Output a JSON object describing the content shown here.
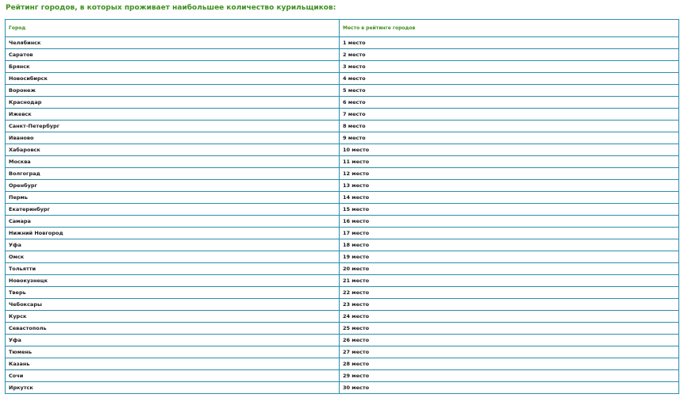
{
  "page": {
    "title": "Рейтинг городов, в которых проживает наибольшее количество курильщиков:"
  },
  "table": {
    "headers": {
      "city": "Город",
      "place": "Место в рейтинге городов"
    },
    "rows": [
      {
        "city": "Челябинск",
        "place": "1 место"
      },
      {
        "city": "Саратов",
        "place": "2 место"
      },
      {
        "city": "Брянск",
        "place": "3 место"
      },
      {
        "city": "Новосибирск",
        "place": "4 место"
      },
      {
        "city": "Воронеж",
        "place": "5 место"
      },
      {
        "city": "Краснодар",
        "place": "6 место"
      },
      {
        "city": "Ижевск",
        "place": "7 место"
      },
      {
        "city": "Санкт-Петербург",
        "place": "8 место"
      },
      {
        "city": "Иваново",
        "place": "9 место"
      },
      {
        "city": "Хабаровск",
        "place": "10 место"
      },
      {
        "city": "Москва",
        "place": "11 место"
      },
      {
        "city": "Волгоград",
        "place": "12 место"
      },
      {
        "city": "Оренбург",
        "place": "13 место"
      },
      {
        "city": "Пермь",
        "place": "14 место"
      },
      {
        "city": "Екатеринбург",
        "place": "15 место"
      },
      {
        "city": "Самара",
        "place": "16 место"
      },
      {
        "city": "Нижний Новгород",
        "place": "17 место"
      },
      {
        "city": "Уфа",
        "place": "18 место"
      },
      {
        "city": "Омск",
        "place": "19 место"
      },
      {
        "city": "Тольятти",
        "place": "20 место"
      },
      {
        "city": "Новокузнецк",
        "place": "21 место"
      },
      {
        "city": "Тверь",
        "place": "22 место"
      },
      {
        "city": "Чебоксары",
        "place": "23 место"
      },
      {
        "city": "Курск",
        "place": "24 место"
      },
      {
        "city": "Севастополь",
        "place": "25 место"
      },
      {
        "city": "Уфа",
        "place": "26 место"
      },
      {
        "city": "Тюмень",
        "place": "27 место"
      },
      {
        "city": "Казань",
        "place": "28 место"
      },
      {
        "city": "Сочи",
        "place": "29 место"
      },
      {
        "city": "Иркутск",
        "place": "30 место"
      }
    ]
  },
  "colors": {
    "accent_green": "#3f8f21",
    "border_blue": "#2a8fae",
    "text": "#1a1a1a",
    "background": "#ffffff"
  }
}
